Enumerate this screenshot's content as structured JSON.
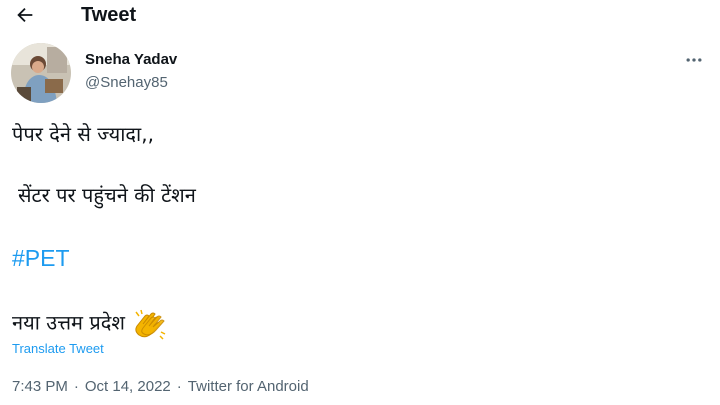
{
  "header": {
    "title": "Tweet",
    "back_icon": "arrow-left-icon"
  },
  "author": {
    "display_name": "Sneha Yadav",
    "handle": "@Snehay85",
    "avatar_icon": "avatar"
  },
  "menu": {
    "icon": "more-horizontal-icon"
  },
  "tweet": {
    "line1": "पेपर देने से ज्यादा,,",
    "line2": "सेंटर पर पहुंचने की टेंशन",
    "hashtag": "#PET",
    "line3": "नया उत्तम प्रदेश",
    "emoji_icon": "clapping-hands-icon",
    "translate_label": "Translate Tweet"
  },
  "meta": {
    "time": "7:43 PM",
    "date": "Oct 14, 2022",
    "source": "Twitter for Android",
    "separator": "·"
  },
  "colors": {
    "accent": "#1d9bf0",
    "text": "#0f1419",
    "muted": "#536471"
  }
}
